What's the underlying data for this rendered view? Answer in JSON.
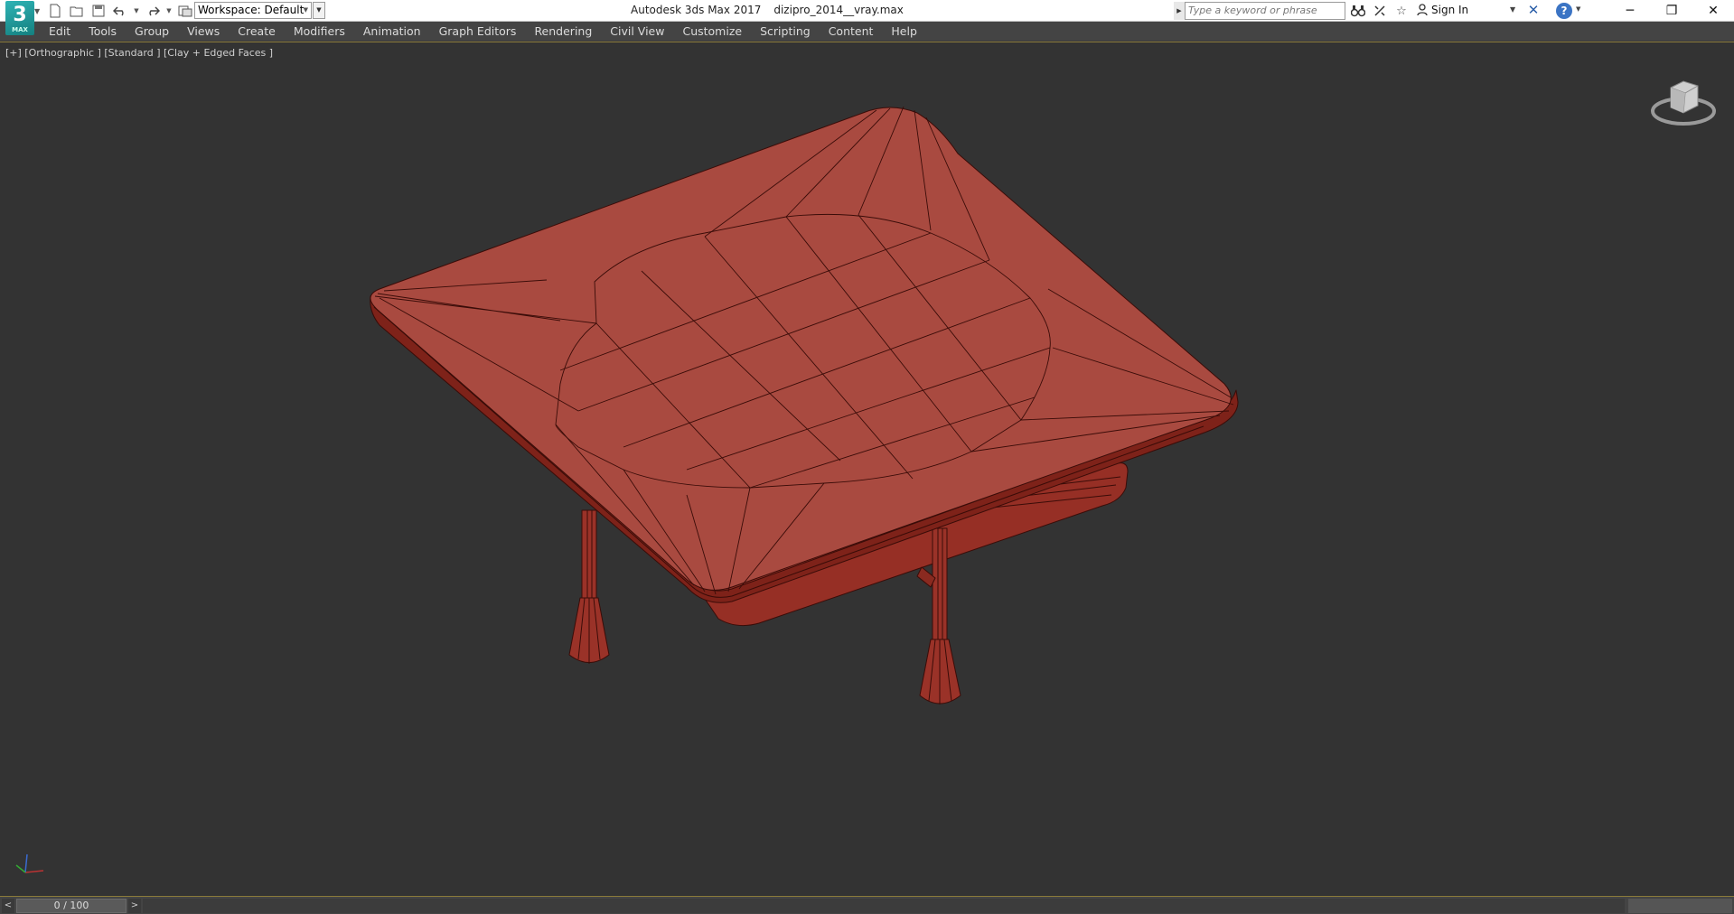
{
  "titlebar": {
    "logo_text": "3",
    "logo_sub": "MAX",
    "workspace_label": "Workspace: Default",
    "app_name": "Autodesk 3ds Max 2017",
    "file_name": "dizipro_2014__vray.max",
    "search_placeholder": "Type a keyword or phrase",
    "sign_in": "Sign In"
  },
  "menu": {
    "items": [
      "Edit",
      "Tools",
      "Group",
      "Views",
      "Create",
      "Modifiers",
      "Animation",
      "Graph Editors",
      "Rendering",
      "Civil View",
      "Customize",
      "Scripting",
      "Content",
      "Help"
    ]
  },
  "viewport": {
    "label": "[+] [Orthographic ] [Standard ] [Clay + Edged Faces ]",
    "object_color": "#a94a40",
    "edge_color": "#3a0c08",
    "background_color": "#333333"
  },
  "timeslider": {
    "frame_display": "0 / 100",
    "prev": "<",
    "next": ">"
  },
  "colors": {
    "title_bg": "#ffffff",
    "menu_bg": "#444444",
    "accent_frame": "#8a7a3a"
  }
}
